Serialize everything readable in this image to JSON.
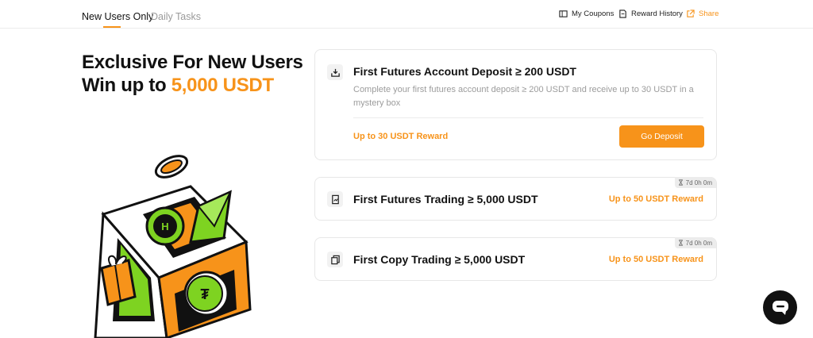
{
  "nav": {
    "tabs": [
      {
        "label": "New Users Only",
        "active": true
      },
      {
        "label": "Daily Tasks",
        "active": false
      }
    ],
    "my_coupons": "My Coupons",
    "reward_history": "Reward History",
    "share": "Share"
  },
  "hero": {
    "line1": "Exclusive For New Users",
    "line2_prefix": "Win up to ",
    "line2_amount": "5,000 USDT"
  },
  "tasks": [
    {
      "icon": "deposit-icon",
      "title": "First Futures Account Deposit ≥ 200 USDT",
      "description": "Complete your first futures account deposit ≥ 200 USDT and receive up to 30 USDT in a mystery box",
      "reward": "Up to 30 USDT Reward",
      "button": "Go Deposit"
    },
    {
      "icon": "futures-trading-icon",
      "title": "First Futures Trading ≥ 5,000 USDT",
      "reward": "Up to 50 USDT Reward",
      "timer": "7d 0h 0m"
    },
    {
      "icon": "copy-trading-icon",
      "title": "First Copy Trading ≥ 5,000 USDT",
      "reward": "Up to 50 USDT Reward",
      "timer": "7d 0h 0m"
    }
  ],
  "colors": {
    "accent": "#f7931a",
    "green": "#7ed321",
    "text": "#111111",
    "muted": "#9c9c9c"
  }
}
